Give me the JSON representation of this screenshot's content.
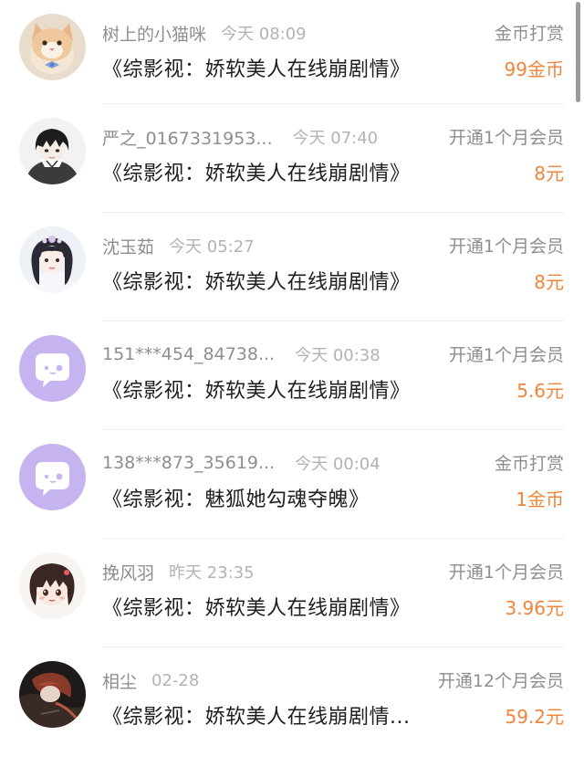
{
  "colors": {
    "amount": "#f0853b",
    "muted_text": "#8e8e8e",
    "time_text": "#b3b3b3",
    "default_avatar_bg": "#c6b4f0"
  },
  "records": [
    {
      "user_name": "树上的小猫咪",
      "time": "今天 08:09",
      "book_title": "《综影视：娇软美人在线崩剧情》",
      "action": "金币打赏",
      "amount": "99金币",
      "avatar": "cat-photo-avatar"
    },
    {
      "user_name": "严之_0167331953...",
      "time": "今天 07:40",
      "book_title": "《综影视：娇软美人在线崩剧情》",
      "action": "开通1个月会员",
      "amount": "8元",
      "avatar": "anime-boy-avatar"
    },
    {
      "user_name": "沈玉茹",
      "time": "今天 05:27",
      "book_title": "《综影视：娇软美人在线崩剧情》",
      "action": "开通1个月会员",
      "amount": "8元",
      "avatar": "costume-girl-avatar"
    },
    {
      "user_name": "151***454_84738...",
      "time": "今天 00:38",
      "book_title": "《综影视：娇软美人在线崩剧情》",
      "action": "开通1个月会员",
      "amount": "5.6元",
      "avatar": "default-chat-avatar"
    },
    {
      "user_name": "138***873_35619...",
      "time": "今天 00:04",
      "book_title": "《综影视：魅狐她勾魂夺魄》",
      "action": "金币打赏",
      "amount": "1金币",
      "avatar": "default-chat-avatar"
    },
    {
      "user_name": "挽风羽",
      "time": "昨天 23:35",
      "book_title": "《综影视：娇软美人在线崩剧情》",
      "action": "开通1个月会员",
      "amount": "3.96元",
      "avatar": "chibi-girl-avatar"
    },
    {
      "user_name": "相尘",
      "time": "02-28",
      "book_title": "《综影视：娇软美人在线崩剧情...",
      "action": "开通12个月会员",
      "amount": "59.2元",
      "avatar": "dark-art-avatar"
    }
  ]
}
